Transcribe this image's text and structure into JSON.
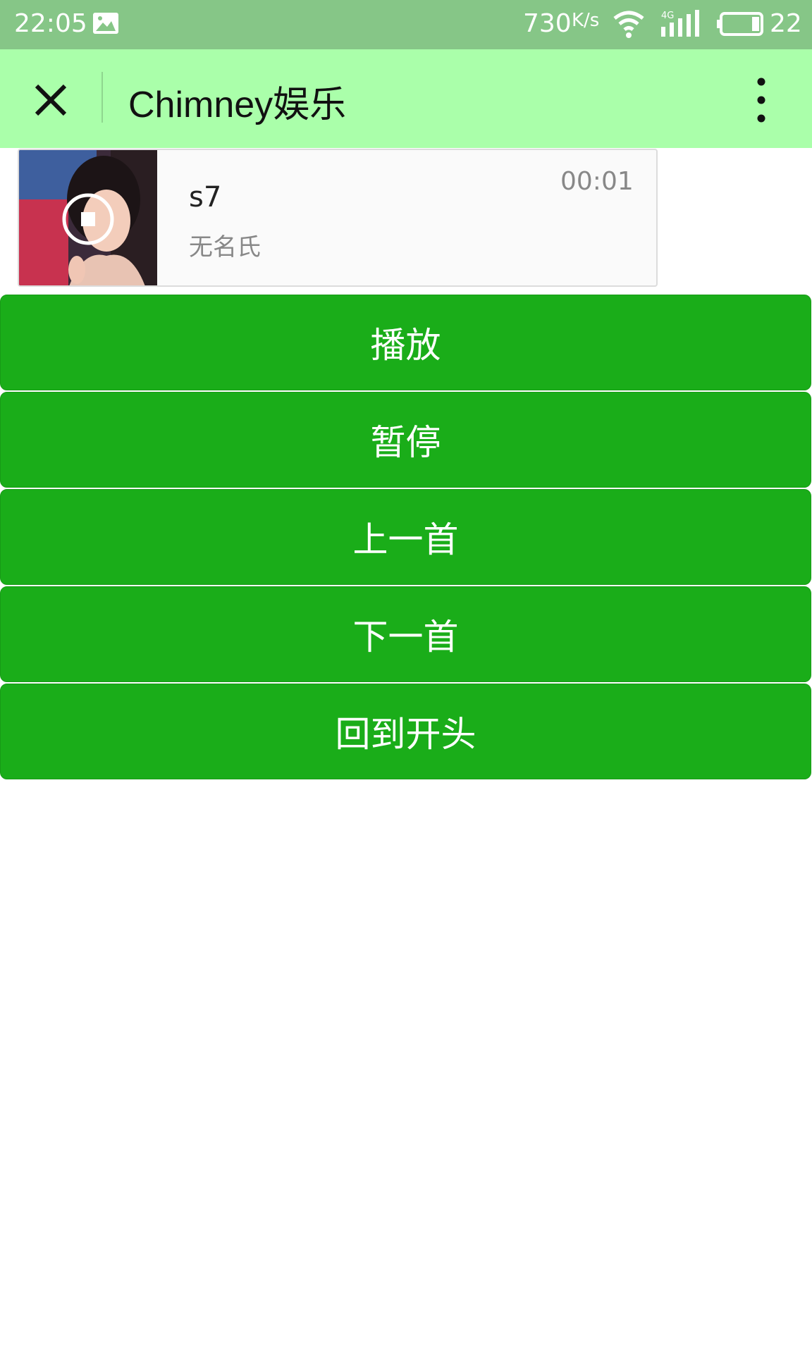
{
  "status_bar": {
    "time": "22:05",
    "speed_value": "730",
    "speed_unit": "K/s",
    "network": "4G",
    "battery": "22",
    "icons": [
      "image-icon",
      "wifi-icon",
      "signal-icon",
      "battery-icon"
    ]
  },
  "title_bar": {
    "title": "Chimney娱乐",
    "close_icon": "close-icon",
    "more_icon": "more-vertical-icon",
    "background": "#aaffaa"
  },
  "player": {
    "song_name": "s7",
    "author": "无名氏",
    "time": "00:01",
    "control_icon": "stop-icon"
  },
  "buttons": {
    "play": "播放",
    "pause": "暂停",
    "previous": "上一首",
    "next": "下一首",
    "restart": "回到开头",
    "color": "#1aad19"
  }
}
